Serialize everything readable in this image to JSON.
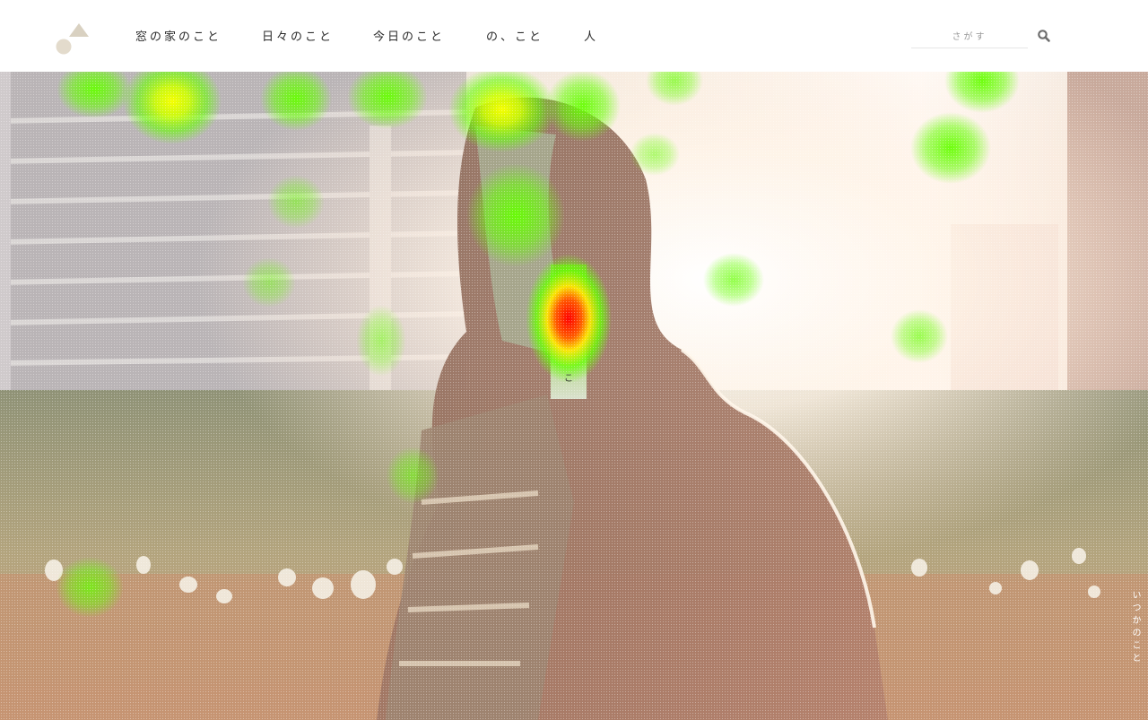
{
  "header": {
    "logo_icon": "triangle-circle-logo-icon",
    "nav": [
      {
        "label": "窓の家のこと"
      },
      {
        "label": "日々のこと"
      },
      {
        "label": "今日のこと"
      },
      {
        "label": "の、こと"
      },
      {
        "label": "人"
      }
    ],
    "search": {
      "placeholder": "さがす",
      "icon": "search-icon"
    }
  },
  "hero": {
    "side_label": "いつかのこと",
    "overlay_char": "こ",
    "image": "backlit-person-riverside-photo"
  },
  "colors": {
    "logo_triangle": "#d9d1c1",
    "logo_circle": "#e3dbcc",
    "heat_green": "#6cff00",
    "heat_yellow": "#f0ff00",
    "heat_red": "#ff0000"
  }
}
